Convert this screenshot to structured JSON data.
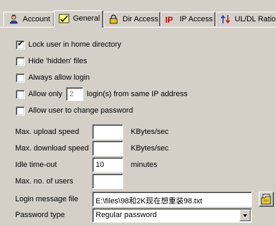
{
  "tabs": [
    {
      "label": "Account",
      "icon": "user-icon",
      "active": false
    },
    {
      "label": "General",
      "icon": "general-settings-icon",
      "active": true
    },
    {
      "label": "Dir Access",
      "icon": "padlock-icon",
      "active": false
    },
    {
      "label": "IP Access",
      "icon": "ip-icon",
      "active": false
    },
    {
      "label": "UL/DL Ratio",
      "icon": "ul-dl-ratio-icon",
      "active": false
    }
  ],
  "options": {
    "lock_home": {
      "label": "Lock user in home directory",
      "checked": true
    },
    "hide_hidden": {
      "label": "Hide 'hidden' files",
      "checked": false
    },
    "always_login": {
      "label": "Always allow login",
      "checked": false
    },
    "allow_only": {
      "label": "Allow only",
      "checked": false,
      "value": "2",
      "suffix": "login(s) from same IP address"
    },
    "change_password": {
      "label": "Allow user to change password",
      "checked": false
    }
  },
  "limits": {
    "upload": {
      "label": "Max. upload speed",
      "value": "",
      "unit": "KBytes/sec"
    },
    "download": {
      "label": "Max. download speed",
      "value": "",
      "unit": "KBytes/sec"
    },
    "idle": {
      "label": "Idle time-out",
      "value": "10",
      "unit": "minutes"
    },
    "users": {
      "label": "Max. no. of users",
      "value": ""
    }
  },
  "login_message": {
    "label": "Login message file",
    "value": "E:\\files\\98和2K现在想重装98.txt"
  },
  "password_type": {
    "label": "Password type",
    "value": "Regular password"
  }
}
